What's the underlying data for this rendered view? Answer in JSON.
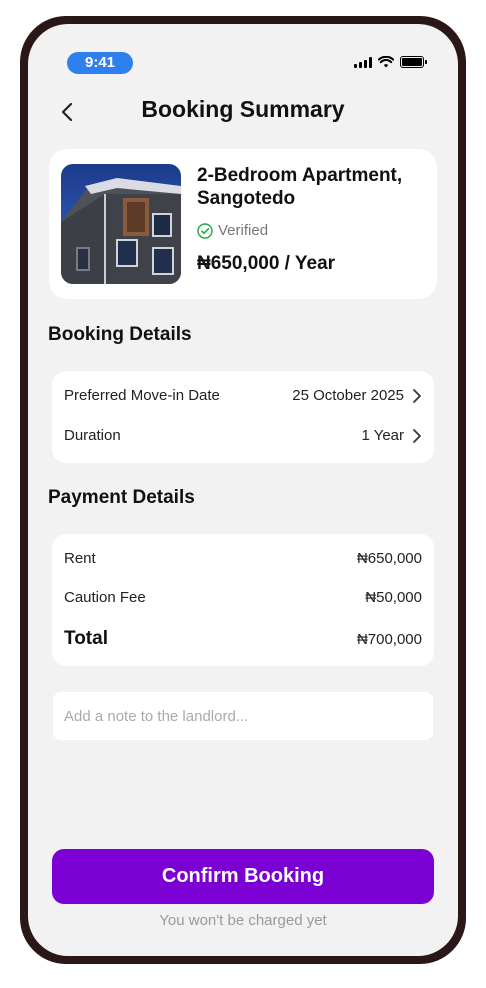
{
  "status_bar": {
    "time": "9:41"
  },
  "header": {
    "title": "Booking Summary"
  },
  "listing": {
    "title": "2-Bedroom Apartment, Sangotedo",
    "verified_label": "Verified",
    "price": "₦650,000 / Year"
  },
  "booking_details": {
    "title": "Booking Details",
    "rows": [
      {
        "label": "Preferred Move-in Date",
        "value": "25 October 2025"
      },
      {
        "label": "Duration",
        "value": "1 Year"
      }
    ]
  },
  "payment_details": {
    "title": "Payment Details",
    "rows": [
      {
        "label": "Rent",
        "value": "₦650,000"
      },
      {
        "label": "Caution Fee",
        "value": "₦50,000"
      }
    ],
    "total": {
      "label": "Total",
      "value": "₦700,000"
    }
  },
  "note": {
    "placeholder": "Add a note to the landlord..."
  },
  "confirm": {
    "label": "Confirm Booking",
    "note": "You won't be charged yet"
  },
  "colors": {
    "accent": "#7b00d4",
    "verified": "#1fa94a",
    "time_pill": "#2f80ed",
    "frame": "#2a1718",
    "background": "#f2f2f2"
  }
}
